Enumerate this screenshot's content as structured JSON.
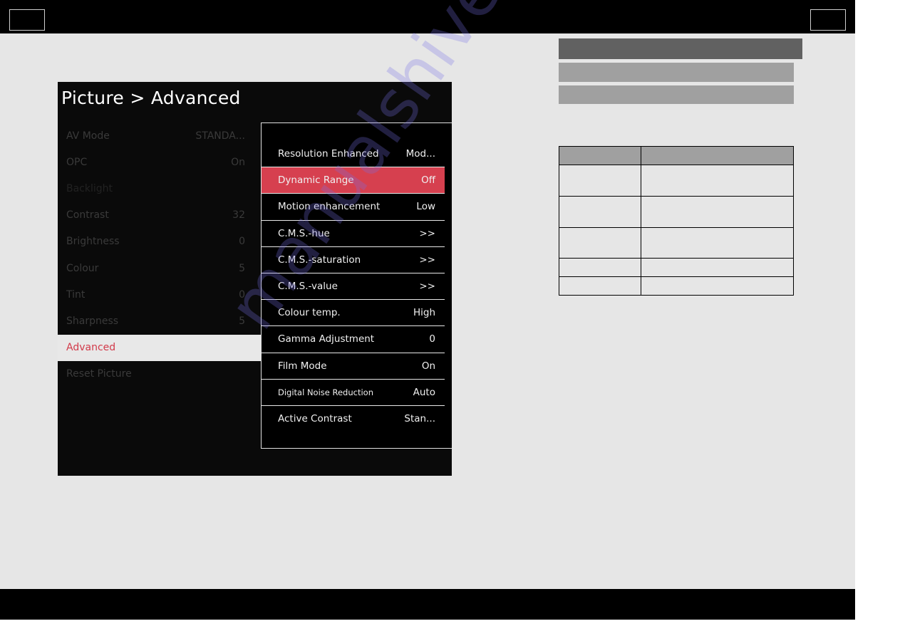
{
  "tv_menu": {
    "title": "Picture > Advanced",
    "left_items": [
      {
        "label": "AV Mode",
        "value": "STANDA..."
      },
      {
        "label": "OPC",
        "value": "On"
      },
      {
        "label": "Backlight",
        "value": ""
      },
      {
        "label": "Contrast",
        "value": "32"
      },
      {
        "label": "Brightness",
        "value": "0"
      },
      {
        "label": "Colour",
        "value": "5"
      },
      {
        "label": "Tint",
        "value": "0"
      },
      {
        "label": "Sharpness",
        "value": "5"
      },
      {
        "label": "Advanced",
        "value": ""
      },
      {
        "label": "Reset Picture",
        "value": ""
      }
    ],
    "left_selected": "Advanced",
    "sub_items": [
      {
        "label": "Resolution Enhanced",
        "value": "Mod..."
      },
      {
        "label": "Dynamic Range",
        "value": "Off"
      },
      {
        "label": "Motion enhancement",
        "value": "Low"
      },
      {
        "label": "C.M.S.-hue",
        "value": ">>"
      },
      {
        "label": "C.M.S.-saturation",
        "value": ">>"
      },
      {
        "label": "C.M.S.-value",
        "value": ">>"
      },
      {
        "label": "Colour temp.",
        "value": "High"
      },
      {
        "label": "Gamma Adjustment",
        "value": "0"
      },
      {
        "label": "Film Mode",
        "value": "On"
      },
      {
        "label": "Digital Noise Reduction",
        "value": "Auto"
      },
      {
        "label": "Active Contrast",
        "value": "Stan..."
      }
    ],
    "sub_selected": "Dynamic Range"
  },
  "colors": {
    "highlight": "#d6404f",
    "selected_text": "#d23a4a",
    "page_bg": "#e6e6e6"
  },
  "watermark": "manualshive.com"
}
